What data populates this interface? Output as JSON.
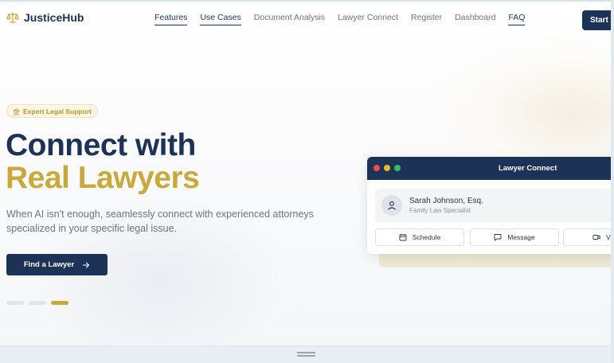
{
  "brand": {
    "name": "JusticeHub",
    "icon": "scale-icon",
    "color": "#1c3256"
  },
  "nav": {
    "items": [
      {
        "label": "Features"
      },
      {
        "label": "Use Cases"
      },
      {
        "label": "Document Analysis"
      },
      {
        "label": "Lawyer Connect"
      },
      {
        "label": "Register"
      },
      {
        "label": "Dashboard"
      },
      {
        "label": "FAQ"
      }
    ],
    "cta": "Start C"
  },
  "hero": {
    "badge": "Expert Legal Support",
    "badge_icon": "building-icon",
    "headline_line1": "Connect with",
    "headline_line2": "Real Lawyers",
    "description": "When AI isn't enough, seamlessly connect with experienced attorneys specialized in your specific legal issue.",
    "cta": "Find a Lawyer",
    "cta_icon": "arrow-right-icon",
    "slides": 3,
    "active_slide": 3
  },
  "connect_card": {
    "title": "Lawyer Connect",
    "lawyer": {
      "name": "Sarah Johnson, Esq.",
      "specialty": "Family Law Specialist",
      "avatar_icon": "user-icon"
    },
    "actions": [
      {
        "label": "Schedule",
        "icon": "calendar-icon"
      },
      {
        "label": "Message",
        "icon": "chat-icon"
      },
      {
        "label": "V",
        "icon": "video-icon"
      }
    ]
  },
  "colors": {
    "navy": "#1c3256",
    "gold": "#c9a93a",
    "muted": "#6b7480"
  }
}
